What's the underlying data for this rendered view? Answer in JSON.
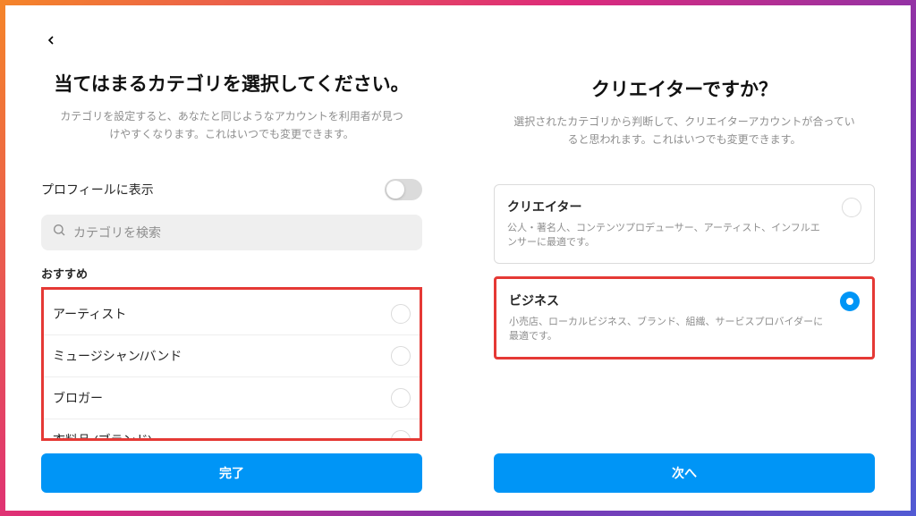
{
  "left": {
    "title": "当てはまるカテゴリを選択してください。",
    "subtitle": "カテゴリを設定すると、あなたと同じようなアカウントを利用者が見つけやすくなります。これはいつでも変更できます。",
    "toggle_label": "プロフィールに表示",
    "search_placeholder": "カテゴリを検索",
    "section_label": "おすすめ",
    "categories": [
      "アーティスト",
      "ミュージシャン/バンド",
      "ブロガー",
      "衣料品 (ブランド)"
    ],
    "button": "完了"
  },
  "right": {
    "title": "クリエイターですか？",
    "subtitle": "選択されたカテゴリから判断して、クリエイターアカウントが合っていると思われます。これはいつでも変更できます。",
    "options": [
      {
        "title": "クリエイター",
        "desc": "公人・著名人、コンテンツプロデューサー、アーティスト、インフルエンサーに最適です。",
        "selected": false
      },
      {
        "title": "ビジネス",
        "desc": "小売店、ローカルビジネス、ブランド、組織、サービスプロバイダーに最適です。",
        "selected": true
      }
    ],
    "button": "次へ"
  }
}
